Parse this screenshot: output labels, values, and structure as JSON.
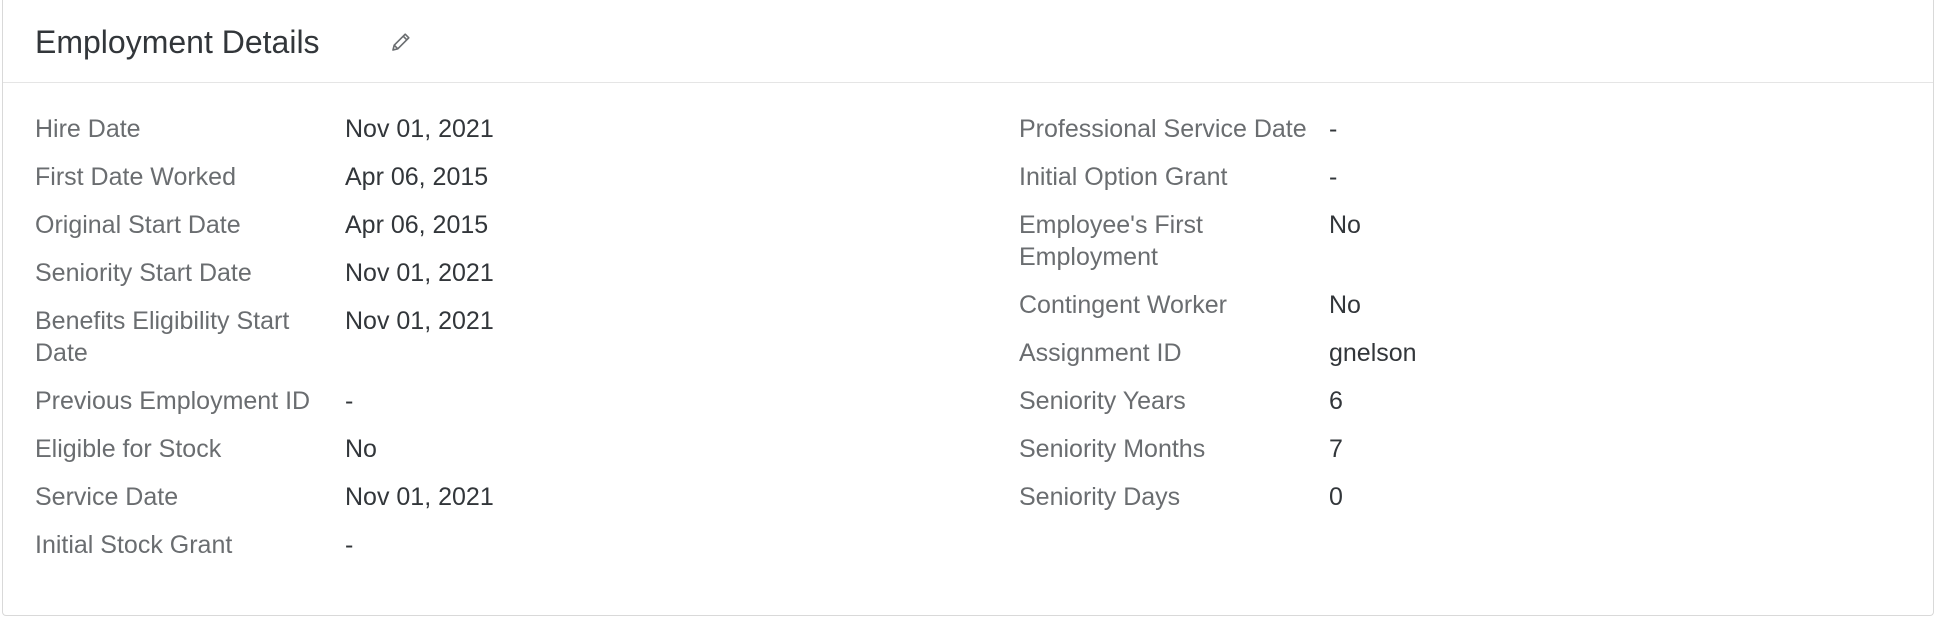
{
  "card": {
    "title": "Employment Details",
    "edit_icon": "pencil-icon"
  },
  "left_fields": [
    {
      "label": "Hire Date",
      "value": "Nov 01, 2021"
    },
    {
      "label": "First Date Worked",
      "value": "Apr 06, 2015"
    },
    {
      "label": "Original Start Date",
      "value": "Apr 06, 2015"
    },
    {
      "label": "Seniority Start Date",
      "value": "Nov 01, 2021"
    },
    {
      "label": "Benefits Eligibility Start Date",
      "value": "Nov 01, 2021"
    },
    {
      "label": "Previous Employment ID",
      "value": "-"
    },
    {
      "label": "Eligible for Stock",
      "value": "No"
    },
    {
      "label": "Service Date",
      "value": "Nov 01, 2021"
    },
    {
      "label": "Initial Stock Grant",
      "value": "-"
    }
  ],
  "right_fields": [
    {
      "label": "Professional Service Date",
      "value": "-"
    },
    {
      "label": "Initial Option Grant",
      "value": "-"
    },
    {
      "label": "Employee's First Employment",
      "value": "No"
    },
    {
      "label": "Contingent Worker",
      "value": "No"
    },
    {
      "label": "Assignment ID",
      "value": "gnelson"
    },
    {
      "label": "Seniority Years",
      "value": "6"
    },
    {
      "label": "Seniority Months",
      "value": "7"
    },
    {
      "label": "Seniority Days",
      "value": "0"
    }
  ]
}
